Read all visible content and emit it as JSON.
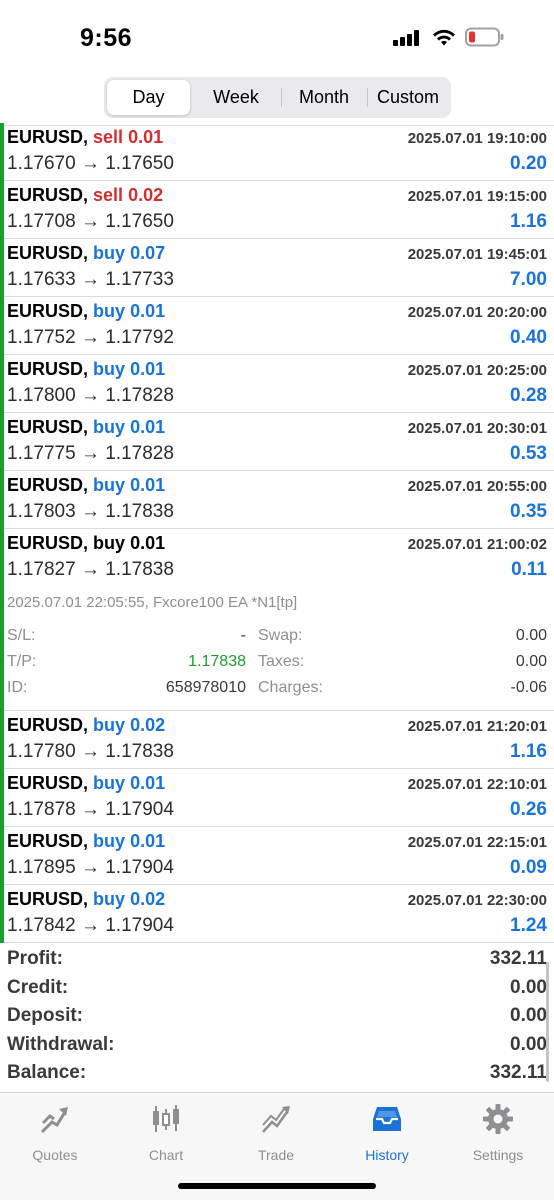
{
  "status": {
    "time": "9:56"
  },
  "period_tabs": [
    {
      "label": "Day",
      "active": true
    },
    {
      "label": "Week",
      "active": false
    },
    {
      "label": "Month",
      "active": false
    },
    {
      "label": "Custom",
      "active": false
    }
  ],
  "deals": [
    {
      "symbol": "EURUSD,",
      "side": "sell",
      "volume": "0.01",
      "time": "2025.07.01 19:10:00",
      "prices": "1.17670 → 1.17650",
      "profit": "0.20"
    },
    {
      "symbol": "EURUSD,",
      "side": "sell",
      "volume": "0.02",
      "time": "2025.07.01 19:15:00",
      "prices": "1.17708 → 1.17650",
      "profit": "1.16"
    },
    {
      "symbol": "EURUSD,",
      "side": "buy",
      "volume": "0.07",
      "time": "2025.07.01 19:45:01",
      "prices": "1.17633 → 1.17733",
      "profit": "7.00"
    },
    {
      "symbol": "EURUSD,",
      "side": "buy",
      "volume": "0.01",
      "time": "2025.07.01 20:20:00",
      "prices": "1.17752 → 1.17792",
      "profit": "0.40"
    },
    {
      "symbol": "EURUSD,",
      "side": "buy",
      "volume": "0.01",
      "time": "2025.07.01 20:25:00",
      "prices": "1.17800 → 1.17828",
      "profit": "0.28"
    },
    {
      "symbol": "EURUSD,",
      "side": "buy",
      "volume": "0.01",
      "time": "2025.07.01 20:30:01",
      "prices": "1.17775 → 1.17828",
      "profit": "0.53"
    },
    {
      "symbol": "EURUSD,",
      "side": "buy",
      "volume": "0.01",
      "time": "2025.07.01 20:55:00",
      "prices": "1.17803 → 1.17838",
      "profit": "0.35"
    }
  ],
  "expanded_deal": {
    "symbol": "EURUSD,",
    "side": "buy",
    "volume": "0.01",
    "time": "2025.07.01 21:00:02",
    "prices": "1.17827 → 1.17838",
    "profit": "0.11",
    "comment": "2025.07.01 22:05:55, Fxcore100 EA *N1[tp]",
    "sl_label": "S/L:",
    "sl_value": "-",
    "tp_label": "T/P:",
    "tp_value": "1.17838",
    "id_label": "ID:",
    "id_value": "658978010",
    "swap_label": "Swap:",
    "swap_value": "0.00",
    "taxes_label": "Taxes:",
    "taxes_value": "0.00",
    "charges_label": "Charges:",
    "charges_value": "-0.06"
  },
  "deals_after": [
    {
      "symbol": "EURUSD,",
      "side": "buy",
      "volume": "0.02",
      "time": "2025.07.01 21:20:01",
      "prices": "1.17780 → 1.17838",
      "profit": "1.16"
    },
    {
      "symbol": "EURUSD,",
      "side": "buy",
      "volume": "0.01",
      "time": "2025.07.01 22:10:01",
      "prices": "1.17878 → 1.17904",
      "profit": "0.26"
    },
    {
      "symbol": "EURUSD,",
      "side": "buy",
      "volume": "0.01",
      "time": "2025.07.01 22:15:01",
      "prices": "1.17895 → 1.17904",
      "profit": "0.09"
    },
    {
      "symbol": "EURUSD,",
      "side": "buy",
      "volume": "0.02",
      "time": "2025.07.01 22:30:00",
      "prices": "1.17842 → 1.17904",
      "profit": "1.24"
    }
  ],
  "summary": [
    {
      "label": "Profit:",
      "value": "332.11"
    },
    {
      "label": "Credit:",
      "value": "0.00"
    },
    {
      "label": "Deposit:",
      "value": "0.00"
    },
    {
      "label": "Withdrawal:",
      "value": "0.00"
    },
    {
      "label": "Balance:",
      "value": "332.11"
    }
  ],
  "tabbar": [
    {
      "label": "Quotes",
      "icon": "quotes-icon",
      "active": false
    },
    {
      "label": "Chart",
      "icon": "chart-icon",
      "active": false
    },
    {
      "label": "Trade",
      "icon": "trade-icon",
      "active": false
    },
    {
      "label": "History",
      "icon": "history-icon",
      "active": true
    },
    {
      "label": "Settings",
      "icon": "settings-icon",
      "active": false
    }
  ],
  "colors": {
    "sell": "#d32f2f",
    "buy": "#1a73d9",
    "accent_bar": "#1a9f2e",
    "tab_active": "#1a73d9"
  }
}
